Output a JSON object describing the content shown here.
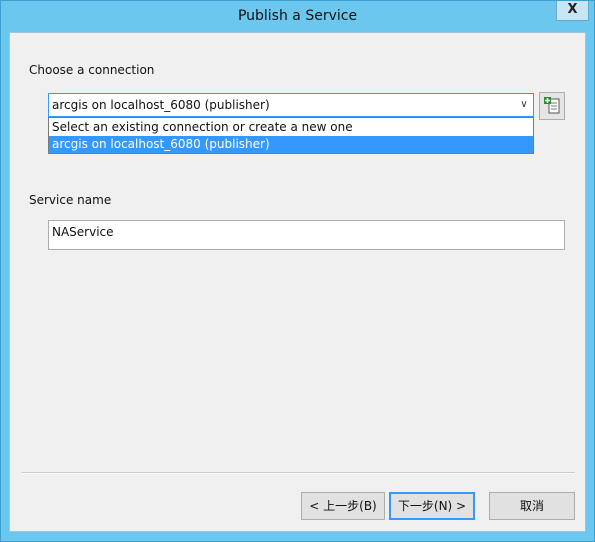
{
  "window": {
    "title": "Publish a Service",
    "close_label": "X"
  },
  "connection": {
    "label": "Choose a connection",
    "selected_value": "arcgis on localhost_6080 (publisher)",
    "dropdown_arrow": "∨",
    "options": [
      "Select an existing connection or create a new one",
      "arcgis on localhost_6080 (publisher)"
    ],
    "highlighted_index": 1,
    "add_button_icon": "add-connection-icon"
  },
  "service": {
    "label": "Service name",
    "value": "NAService"
  },
  "buttons": {
    "back_label": "< 上一步(B)",
    "next_label": "下一步(N) >",
    "cancel_label": "取消"
  },
  "colors": {
    "titlebar": "#6cc7ee",
    "selection": "#3399ff",
    "dialog_bg": "#f0f0f0"
  }
}
